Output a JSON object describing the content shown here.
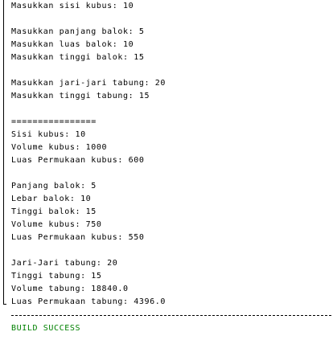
{
  "console": {
    "lines": [
      "Masukkan sisi kubus: 10",
      "",
      "Masukkan panjang balok: 5",
      "Masukkan luas balok: 10",
      "Masukkan tinggi balok: 15",
      "",
      "Masukkan jari-jari tabung: 20",
      "Masukkan tinggi tabung: 15",
      "",
      "================",
      "Sisi kubus: 10",
      "Volume kubus: 1000",
      "Luas Permukaan kubus: 600",
      "",
      "Panjang balok: 5",
      "Lebar balok: 10",
      "Tinggi balok: 15",
      "Volume kubus: 750",
      "Luas Permukaan kubus: 550",
      "",
      "Jari-Jari tabung: 20",
      "Tinggi tabung: 15",
      "Volume tabung: 18840.0",
      "Luas Permukaan tabung: 4396.0"
    ],
    "build_status": "BUILD SUCCESS",
    "build_status_color": "#008000"
  }
}
